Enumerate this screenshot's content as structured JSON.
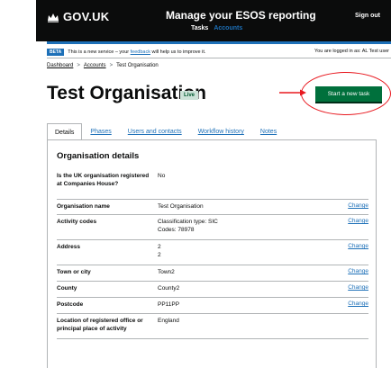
{
  "header": {
    "logo_text": "GOV.UK",
    "service_name": "Manage your ESOS reporting",
    "nav": [
      "Tasks",
      "Accounts"
    ],
    "signout": "Sign out"
  },
  "phase_banner": {
    "tag": "BETA",
    "text_before": "This is a new service – your",
    "link": "feedback",
    "text_after": "will help us to improve it.",
    "logged_in": "You are logged in as: AL Test user"
  },
  "breadcrumbs": [
    "Dashboard",
    "Accounts",
    "Test Organisation"
  ],
  "breadcrumb_separator": ">",
  "page": {
    "title": "Test Organisation",
    "status_tag": "Live",
    "start_button": "Start a new task"
  },
  "tabs": [
    "Details",
    "Phases",
    "Users and contacts",
    "Workflow history",
    "Notes"
  ],
  "details": {
    "heading": "Organisation details",
    "change_label": "Change",
    "rows": [
      {
        "key": "Is the UK organisation registered at Companies House?",
        "value": "No",
        "change": false
      },
      {
        "key": "Organisation name",
        "value": "Test Organisation",
        "change": true
      },
      {
        "key": "Activity codes",
        "value": "Classification type: SIC\nCodes: 78978",
        "change": true
      },
      {
        "key": "Address",
        "value": "2\n2",
        "change": true
      },
      {
        "key": "Town or city",
        "value": "Town2",
        "change": true
      },
      {
        "key": "County",
        "value": "County2",
        "change": true
      },
      {
        "key": "Postcode",
        "value": "PP11PP",
        "change": true
      },
      {
        "key": "Location of registered office or principal place of activity",
        "value": "England",
        "change": false
      }
    ]
  },
  "colors": {
    "header": "#0b0c0c",
    "link": "#1d70b8",
    "button": "#00703c",
    "annotation": "#e8181f",
    "live_tag_bg": "#cce2d8"
  }
}
